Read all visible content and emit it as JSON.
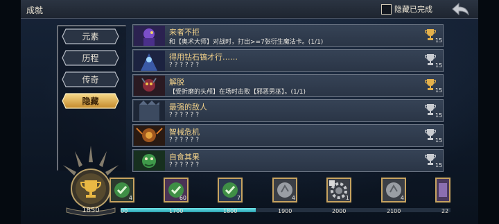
{
  "header": {
    "title": "成就",
    "hide_completed_label": "隐藏已完成",
    "hide_completed_checked": false,
    "back_icon": "back-arrow-icon"
  },
  "tabs": [
    {
      "label": "元素",
      "active": false
    },
    {
      "label": "历程",
      "active": false
    },
    {
      "label": "传奇",
      "active": false
    },
    {
      "label": "隐藏",
      "active": true
    }
  ],
  "achievements": [
    {
      "name": "来者不拒",
      "desc": "和【奥术大师】对战时，打出>=7张衍生魔法卡。(1/1)",
      "points": "15",
      "completed": true
    },
    {
      "name": "得用钻石镐才行……",
      "desc": "? ? ? ? ? ?",
      "points": "15",
      "completed": false
    },
    {
      "name": "解脱",
      "desc": "【受折磨的头颅】在场时击败【邪恶男巫】。(1/1)",
      "points": "15",
      "completed": true
    },
    {
      "name": "最强的敌人",
      "desc": "? ? ? ? ? ?",
      "points": "15",
      "completed": false
    },
    {
      "name": "智械危机",
      "desc": "? ? ? ? ? ?",
      "points": "15",
      "completed": false
    },
    {
      "name": "自食其果",
      "desc": "? ? ? ? ? ?",
      "points": "15",
      "completed": false
    }
  ],
  "score": {
    "value": "1850",
    "icon": "trophy-icon"
  },
  "progress": {
    "fraction": 0.41,
    "ticks": [
      "00",
      "1700",
      "1800",
      "1900",
      "2000",
      "2100",
      "22"
    ]
  },
  "rewards": [
    {
      "count": "4",
      "state": "claimed",
      "icon": "check-icon"
    },
    {
      "count": "60",
      "state": "claimed",
      "icon": "check-icon"
    },
    {
      "count": "7",
      "state": "claimed",
      "icon": "check-icon"
    },
    {
      "count": "4",
      "state": "locked",
      "icon": "stone-icon"
    },
    {
      "count": "1",
      "state": "locked",
      "icon": "gear-skull-icon"
    },
    {
      "count": "4",
      "state": "locked",
      "icon": "stone-icon"
    },
    {
      "count": "",
      "state": "locked",
      "icon": "card-icon"
    }
  ],
  "colors": {
    "accent_gold": "#d9a441",
    "progress_cyan": "#4fc9d4",
    "reward_claimed": "#5fbf5a"
  }
}
